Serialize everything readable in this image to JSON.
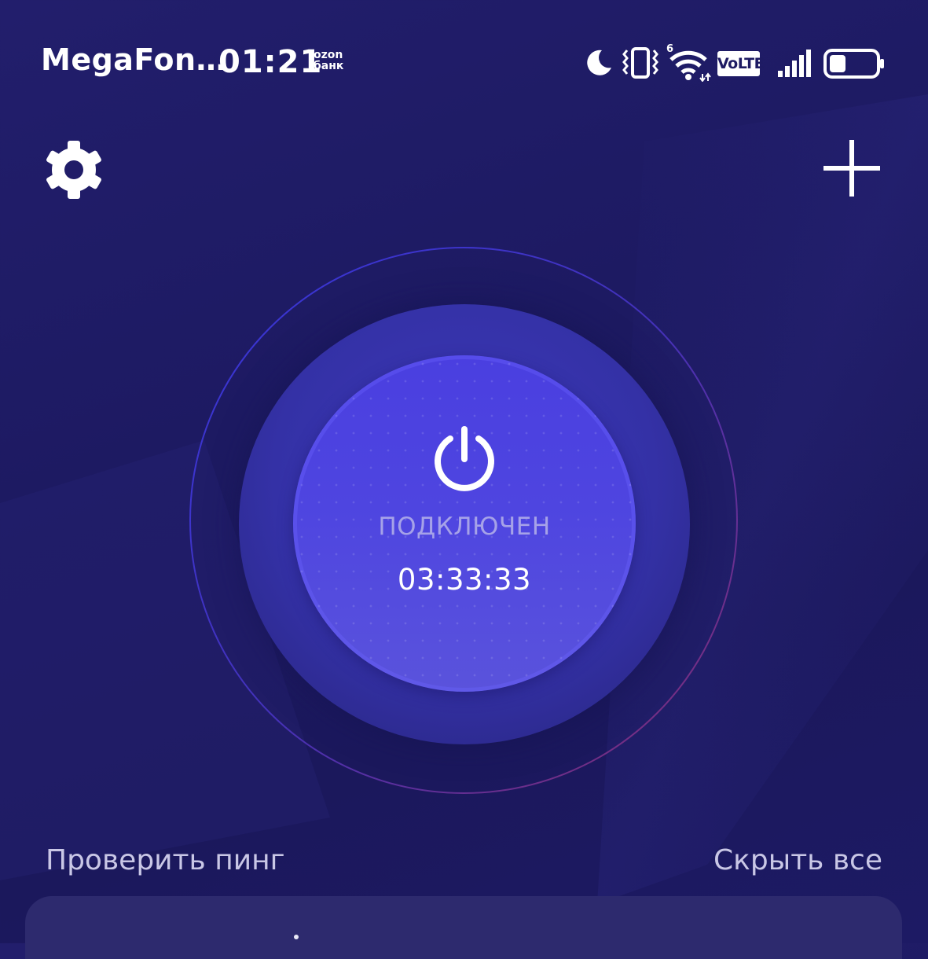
{
  "status_bar": {
    "carrier": "MegaFon…",
    "time": "01:21",
    "notification_line1": "ozon",
    "notification_line2": "банк",
    "icons": [
      "moon-icon",
      "vibrate-icon",
      "wifi-icon",
      "volte-badge",
      "signal-icon",
      "battery-icon"
    ],
    "volte_label": "VoLTE",
    "wifi_label": "6"
  },
  "header": {
    "settings_icon": "gear-icon",
    "add_icon": "plus-icon"
  },
  "connection": {
    "status": "ПОДКЛЮЧЕН",
    "timer": "03:33:33",
    "button_icon": "power-icon"
  },
  "actions": {
    "check_ping": "Проверить пинг",
    "hide_all": "Скрыть все"
  },
  "colors": {
    "background": "#1d1a62",
    "dial_outer": "#3431a6",
    "dial_inner": "#4e45e0",
    "status_text": "#a6a2e8",
    "link_text": "#c9c7e6",
    "card": "#2d2a6e"
  }
}
